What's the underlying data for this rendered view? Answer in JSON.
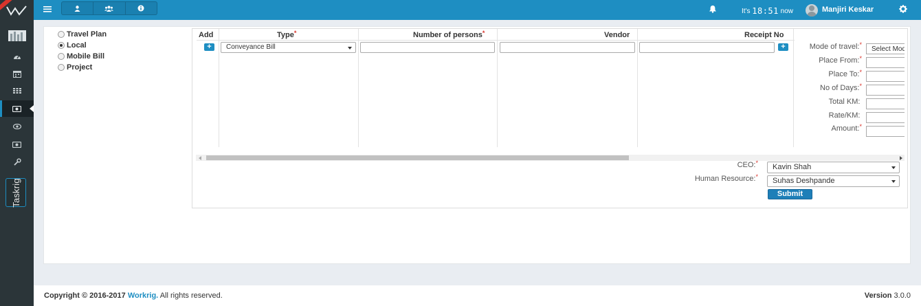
{
  "sidebar": {
    "items": [
      {
        "icon": "building-icon",
        "active": false
      },
      {
        "icon": "dashboard-icon",
        "active": false
      },
      {
        "icon": "calendar-icon",
        "active": false
      },
      {
        "icon": "grid-icon",
        "active": false
      },
      {
        "icon": "money-icon",
        "active": true
      },
      {
        "icon": "eye-icon",
        "active": false
      },
      {
        "icon": "money-icon",
        "active": false
      },
      {
        "icon": "wrench-icon",
        "active": false
      }
    ],
    "taskrig_label": "Taskrig"
  },
  "header": {
    "now_prefix": "It's",
    "clock": "18:51",
    "now_suffix": "now",
    "user_name": "Manjiri Keskar"
  },
  "expense_types": [
    {
      "label": "Travel Plan",
      "selected": false
    },
    {
      "label": "Local",
      "selected": true
    },
    {
      "label": "Mobile Bill",
      "selected": false
    },
    {
      "label": "Project",
      "selected": false
    }
  ],
  "table": {
    "headers": {
      "add": "Add",
      "type": "Type",
      "persons": "Number of persons",
      "vendor": "Vendor",
      "receipt": "Receipt No"
    },
    "row": {
      "type_value": "Conveyance Bill",
      "persons_value": "",
      "vendor_value": "",
      "receipt_value": ""
    },
    "details": {
      "mode_label": "Mode of travel:",
      "mode_value": "Select Mode",
      "place_from_label": "Place From:",
      "place_to_label": "Place To:",
      "days_label": "No of Days:",
      "total_km_label": "Total KM:",
      "rate_label": "Rate/KM:",
      "amount_label": "Amount:"
    }
  },
  "approvers": {
    "ceo_label": "CEO:",
    "ceo_value": "Kavin Shah",
    "hr_label": "Human Resource:",
    "hr_value": "Suhas Deshpande",
    "submit_label": "Submit"
  },
  "footer": {
    "copyright_prefix": "Copyright © 2016-2017",
    "company": "Workrig.",
    "rights": "All rights reserved.",
    "version_label": "Version",
    "version_value": "3.0.0"
  },
  "colors": {
    "brand": "#1e8ec2",
    "sidebar": "#2b3539",
    "required": "#d9342b"
  }
}
